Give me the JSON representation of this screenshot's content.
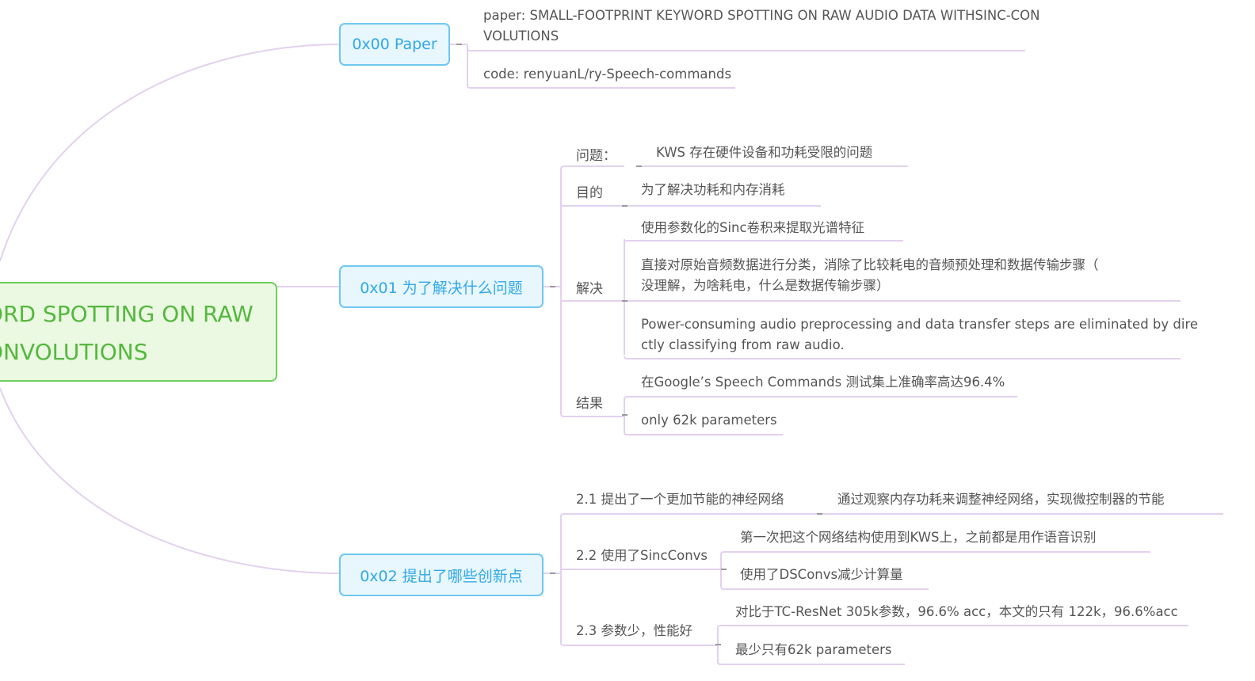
{
  "root": {
    "line1": "ORD SPOTTING ON RAW",
    "line2": "ONVOLUTIONS"
  },
  "topics": {
    "paper": {
      "label": "0x00 Paper",
      "paper_line1": "paper: SMALL-FOOTPRINT KEYWORD SPOTTING ON RAW AUDIO DATA WITHSINC-CON",
      "paper_line2": "VOLUTIONS",
      "code": "code: renyuanL/ry-Speech-commands"
    },
    "problem": {
      "label": "0x01 为了解决什么问题",
      "issue_label": "问题：",
      "issue_text": "KWS 存在硬件设备和功耗受限的问题",
      "goal_label": "目的",
      "goal_text": "为了解决功耗和内存消耗",
      "solve_label": "解决",
      "solve_1": "使用参数化的Sinc卷积来提取光谱特征",
      "solve_2_line1": "直接对原始音频数据进行分类，消除了比较耗电的音频预处理和数据传输步骤（",
      "solve_2_line2": "没理解，为啥耗电，什么是数据传输步骤）",
      "solve_3_line1": "Power-consuming audio preprocessing and data transfer steps are eliminated by dire",
      "solve_3_line2": "ctly classifying from raw audio.",
      "result_label": "结果",
      "result_1": "在Google’s Speech Commands  测试集上准确率高达96.4%",
      "result_2": "only 62k parameters"
    },
    "innovation": {
      "label": "0x02 提出了哪些创新点",
      "i1_label": "2.1 提出了一个更加节能的神经网络",
      "i1_text": "通过观察内存功耗来调整神经网络，实现微控制器的节能",
      "i2_label": "2.2 使用了SincConvs",
      "i2_text1": "第一次把这个网络结构使用到KWS上，之前都是用作语音识别",
      "i2_text2": "使用了DSConvs减少计算量",
      "i3_label": "2.3 参数少，性能好",
      "i3_text1": "对比于TC-ResNet 305k参数，96.6% acc，本文的只有 122k，96.6%acc",
      "i3_text2": "最少只有62k parameters"
    }
  },
  "colors": {
    "connector": "#e2d1ef",
    "root_border": "#6cd05a",
    "root_text": "#54b83e",
    "topic_border": "#6fc8f2",
    "topic_text": "#31a9e8"
  }
}
